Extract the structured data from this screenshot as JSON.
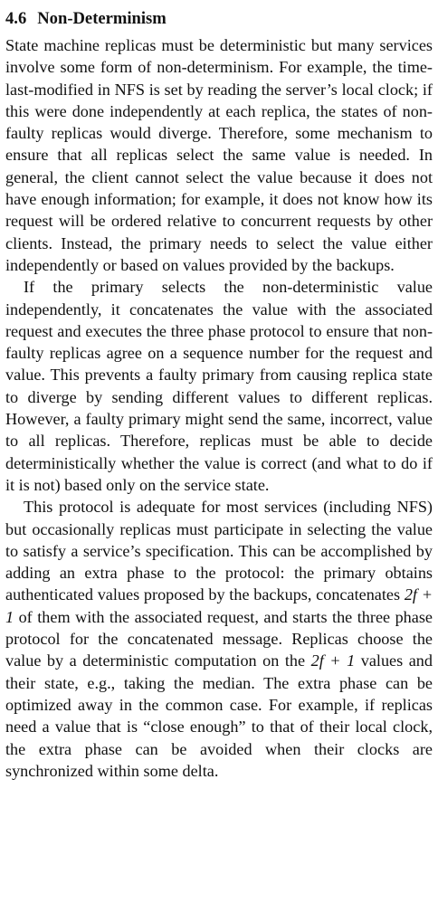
{
  "section": {
    "number": "4.6",
    "title": "Non-Determinism"
  },
  "paragraphs": [
    {
      "parts": [
        "State machine replicas must be deterministic but many services involve some form of non-determinism.  For example, the time-last-modified in NFS is set by reading the server’s local clock; if this were done independently at each replica, the states of non-faulty replicas would diverge.  Therefore, some mechanism to ensure that all replicas select the same value is needed.  In general, the client cannot select the value because it does not have enough information; for example, it does not know how its request will be ordered relative to concurrent requests by other clients.  Instead, the primary needs to select the value either independently or based on values provided by the backups."
      ]
    },
    {
      "parts": [
        "If the primary selects the non-deterministic value independently, it concatenates the value with the associated request and executes the three phase protocol to ensure that non-faulty replicas agree on a sequence number for the request and value. This prevents a faulty primary from causing replica state to diverge by sending different values to different replicas. However, a faulty primary might send the same, incorrect, value to all replicas. Therefore, replicas must be able to decide deterministically whether the value is correct (and what to do if it is not) based only on the service state."
      ]
    },
    {
      "parts": [
        "This protocol is adequate for most services (including NFS) but occasionally replicas must participate in selecting the value to satisfy a service’s specification. This can be accomplished by adding an extra phase to the protocol:  the primary obtains authenticated values proposed by the backups, concatenates ",
        "2f + 1",
        " of them with the associated request, and starts the three phase protocol for the concatenated message. Replicas choose the value by a deterministic computation on the ",
        "2f + 1",
        " values and their state, e.g., taking the median. The extra phase can be optimized away in the common case.  For example, if replicas need a value that is “close enough” to that of their local clock, the extra phase can be avoided when their clocks are synchronized within some delta."
      ]
    }
  ]
}
